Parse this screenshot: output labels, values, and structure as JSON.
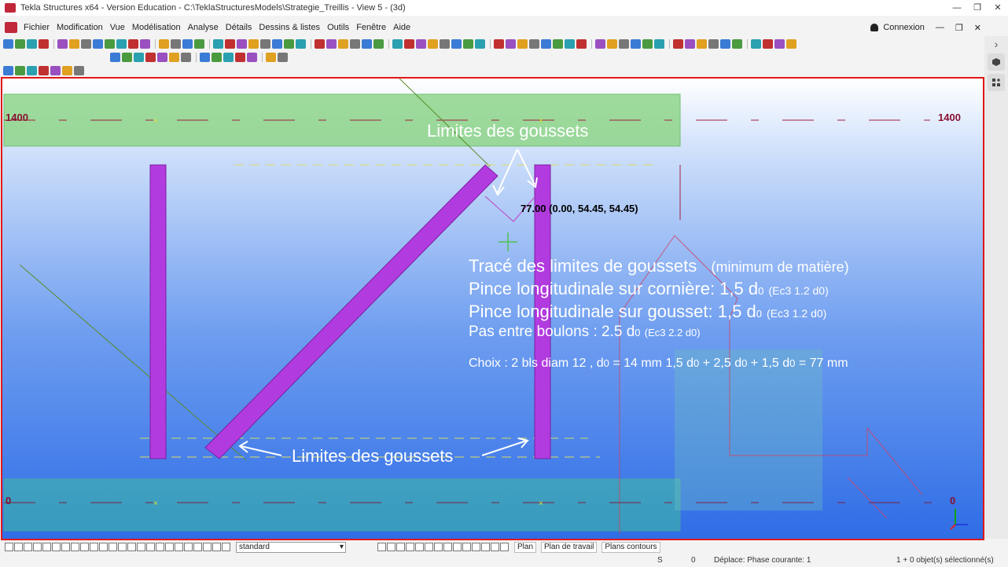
{
  "window": {
    "title": "Tekla Structures x64 - Version Education - C:\\TeklaStructuresModels\\Strategie_Treillis  - View 5 - (3d)",
    "controls": [
      "—",
      "❐",
      "✕"
    ]
  },
  "menu": {
    "items": [
      "Fichier",
      "Modification",
      "Vue",
      "Modélisation",
      "Analyse",
      "Détails",
      "Dessins & listes",
      "Outils",
      "Fenêtre",
      "Aide"
    ],
    "connexion": "Connexion",
    "controls": [
      "—",
      "❐",
      "✕"
    ]
  },
  "sidepanel": {
    "expand": "›",
    "buttons": [
      "cube-icon",
      "add-panel-icon"
    ]
  },
  "viewport": {
    "grid_label_top_left": "1400",
    "grid_label_top_right": "1400",
    "grid_label_bottom_left": "0",
    "grid_label_bottom_right": "0",
    "dimension_label": "77.00 (0.00, 54.45, 54.45)",
    "callout_top": "Limites des goussets",
    "callout_bottom": "Limites des goussets",
    "notes": {
      "line1_main": "Tracé des limites de goussets",
      "line1_small": "(minimum de matière)",
      "line2_main": "Pince longitudinale  sur cornière: 1,5 d",
      "line2_sub": "0",
      "line2_small": "(Ec3 1.2 d0)",
      "line3_main": "Pince longitudinale  sur gousset: 1,5 d",
      "line3_sub": "0",
      "line3_small": "(Ec3 1.2 d0)",
      "line4_main": "Pas entre boulons : 2.5 d",
      "line4_sub": "0",
      "line4_small": "(Ec3 2.2 d0)",
      "line5_a": "Choix : 2 bls diam 12 , d",
      "line5_b": "0",
      "line5_c": " = 14 mm    1,5 d",
      "line5_d": "0",
      "line5_e": " + 2,5 d",
      "line5_f": "0",
      "line5_g": " + 1,5 d",
      "line5_h": "0",
      "line5_i": "  = 77 mm"
    }
  },
  "status": {
    "filter_value": "standard",
    "plan": "Plan",
    "plan_travail": "Plan de travail",
    "plans_contours": "Plans contours"
  },
  "info": {
    "snap": "S",
    "count": "0",
    "phase": "Déplace: Phase courante: 1",
    "selection": "1 + 0 objet(s) sélectionné(s)"
  },
  "colors": {
    "viewport_border": "#e01818",
    "member_purple": "#b23be0",
    "plate_green": "#8fd68a",
    "grid_label": "#8a1030"
  }
}
